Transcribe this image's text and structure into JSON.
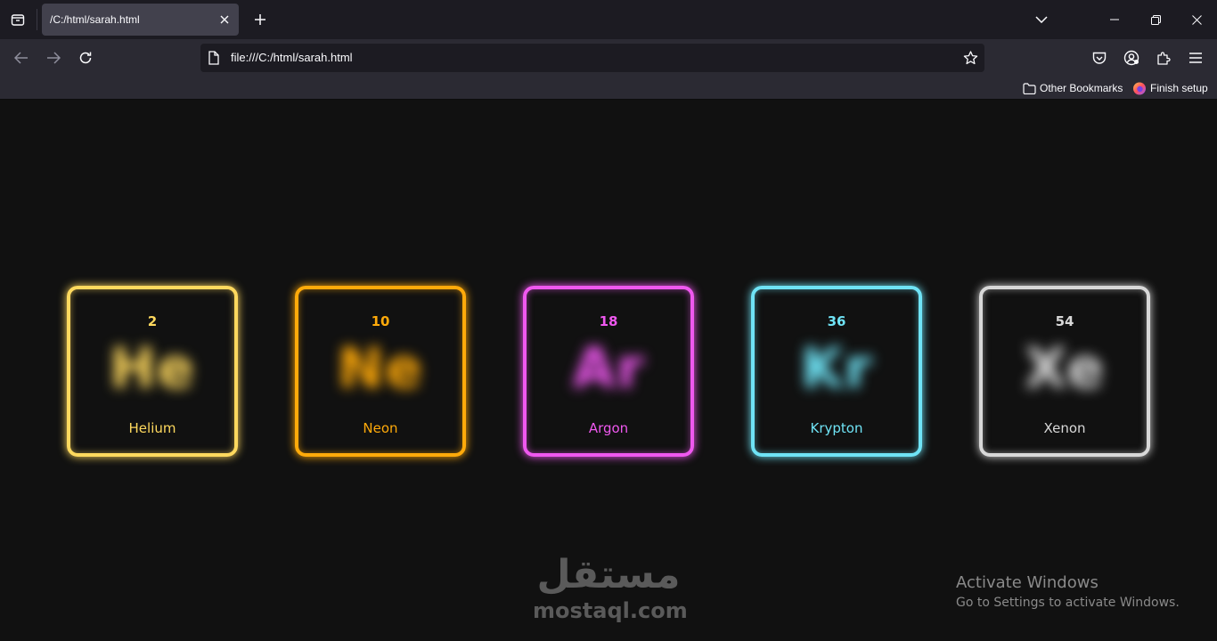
{
  "browser": {
    "tab_title": "/C:/html/sarah.html",
    "url": "file:///C:/html/sarah.html",
    "bookmarks": [
      {
        "label": "Other Bookmarks",
        "icon": "folder-icon"
      },
      {
        "label": "Finish setup",
        "icon": "firefox-icon"
      }
    ]
  },
  "elements": [
    {
      "number": "2",
      "symbol": "He",
      "name": "Helium",
      "color": "#ffd95e"
    },
    {
      "number": "10",
      "symbol": "Ne",
      "name": "Neon",
      "color": "#ffaa0a"
    },
    {
      "number": "18",
      "symbol": "Ar",
      "name": "Argon",
      "color": "#ef58ef"
    },
    {
      "number": "36",
      "symbol": "Kr",
      "name": "Krypton",
      "color": "#6fe3f5"
    },
    {
      "number": "54",
      "symbol": "Xe",
      "name": "Xenon",
      "color": "#d8d8d8"
    }
  ],
  "watermark": {
    "arabic": "مستقل",
    "latin": "mostaql.com"
  },
  "os_notice": {
    "title": "Activate Windows",
    "subtitle": "Go to Settings to activate Windows."
  }
}
